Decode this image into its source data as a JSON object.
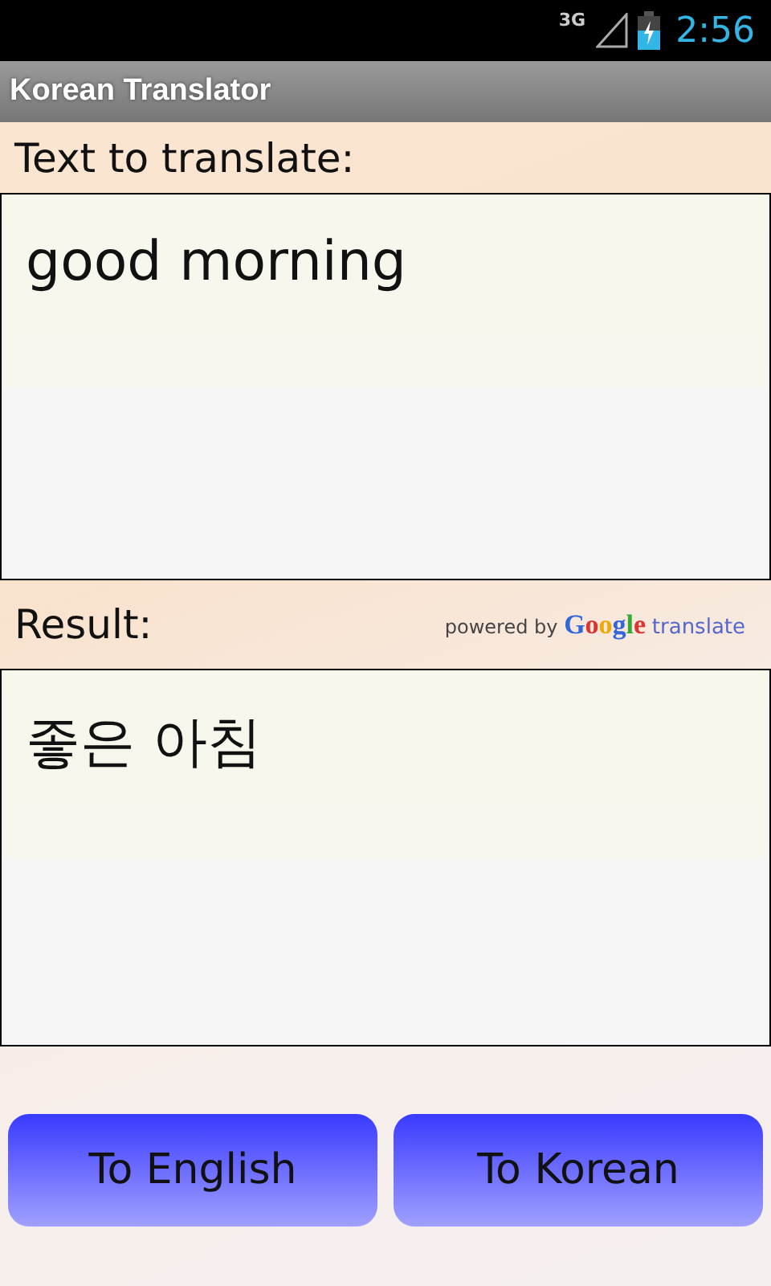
{
  "status_bar": {
    "network": "3G",
    "time": "2:56"
  },
  "title_bar": {
    "title": "Korean Translator"
  },
  "input": {
    "label": "Text to translate:",
    "value": "good morning"
  },
  "result": {
    "label": "Result:",
    "attribution": {
      "prefix": "powered by",
      "brand": "Google",
      "suffix": "translate"
    },
    "text": "좋은 아침"
  },
  "buttons": [
    {
      "label": "To English"
    },
    {
      "label": "To Korean"
    }
  ]
}
